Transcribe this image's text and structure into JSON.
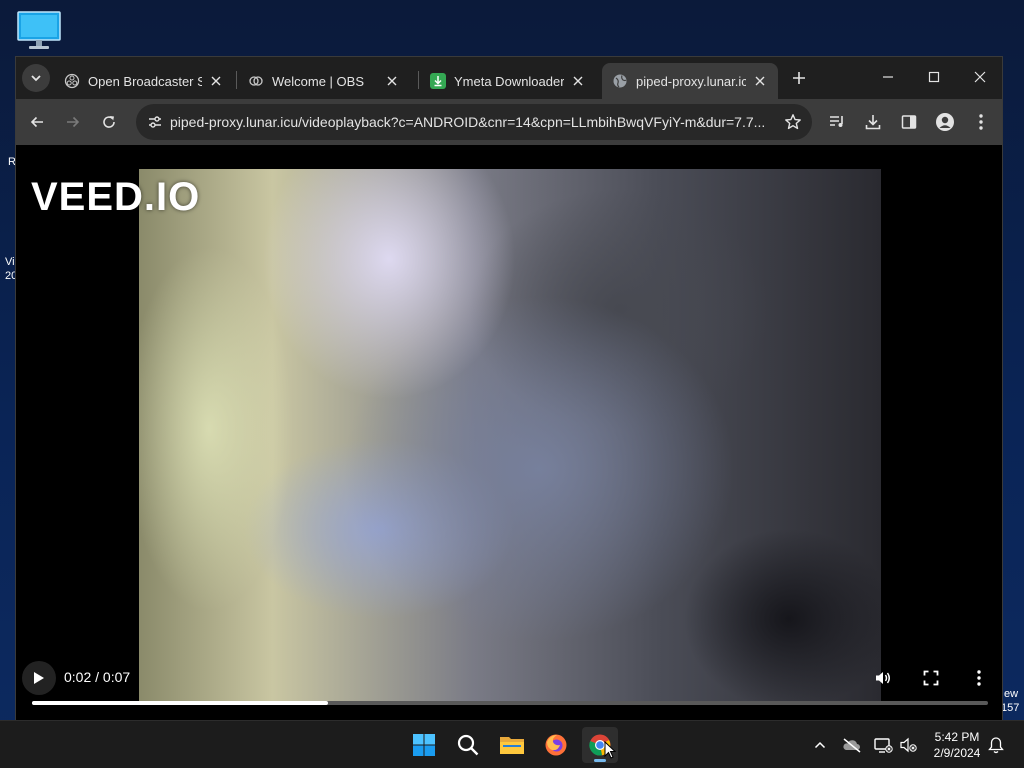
{
  "desktop": {
    "icons": [
      "monitor-icon"
    ],
    "background_fragments": [
      "R",
      "Vi",
      "20",
      "ew",
      "157"
    ]
  },
  "browser": {
    "tabs": [
      {
        "title": "Open Broadcaster So",
        "favicon": "obs-icon",
        "active": false
      },
      {
        "title": "Welcome | OBS",
        "favicon": "obs-icon",
        "active": false
      },
      {
        "title": "Ymeta Downloader –",
        "favicon": "download-icon",
        "active": false
      },
      {
        "title": "piped-proxy.lunar.icu",
        "favicon": "globe-icon",
        "active": true
      }
    ],
    "url": "piped-proxy.lunar.icu/videoplayback?c=ANDROID&cnr=14&cpn=LLmbihBwqVFyiY-m&dur=7.7..."
  },
  "video": {
    "watermark": "VEED.IO",
    "time": "0:02 / 0:07",
    "progress": 0.31
  },
  "taskbar": {
    "clock_time": "5:42 PM",
    "clock_date": "2/9/2024"
  },
  "colors": {
    "accent": "#76b9ed",
    "tab_bar": "#1f1f1f",
    "toolbar": "#3c3c3c",
    "taskbar": "#1c1c1c"
  }
}
